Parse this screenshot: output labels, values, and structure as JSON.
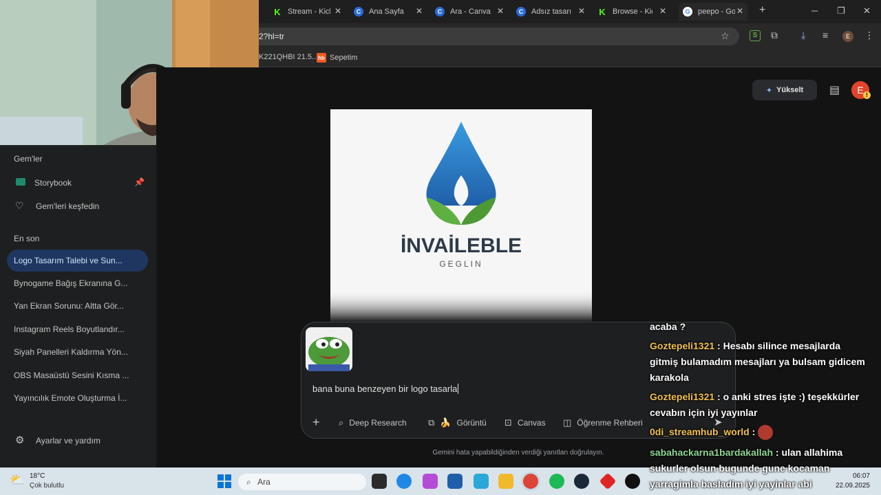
{
  "tabs": [
    {
      "title": "Stream - Kick",
      "icon": "kick-icon"
    },
    {
      "title": "Ana Sayfa - Canva",
      "icon": "canva-icon"
    },
    {
      "title": "Ara - Canva",
      "icon": "canva-icon"
    },
    {
      "title": "Adsız tasarım",
      "icon": "canva-icon"
    },
    {
      "title": "Browse - Kick",
      "icon": "kick-icon"
    },
    {
      "title": "peepo - Google",
      "icon": "google-icon"
    }
  ],
  "address_bar": {
    "url_fragment": "2?hl=tr"
  },
  "bookmarks": [
    {
      "label": "K221QHBI 21.5..."
    },
    {
      "label": "Sepetim",
      "icon": "hb"
    }
  ],
  "profile_initial": "E",
  "sidebar": {
    "gems_heading": "Gem'ler",
    "gems": [
      {
        "label": "Storybook"
      },
      {
        "label": "Gem'leri keşfedin"
      }
    ],
    "recent_heading": "En son",
    "recent": [
      "Logo Tasarım Talebi ve Sun...",
      "Bynogame Bağış Ekranına G...",
      "Yan Ekran Sorunu: Altta Gör...",
      "Instagram Reels Boyutlandır...",
      "Siyah Panelleri Kaldırma Yön...",
      "OBS Masaüstü Sesini Kısma ...",
      "Yayıncılık Emote Oluşturma İ..."
    ],
    "settings_label": "Ayarlar ve yardım"
  },
  "header": {
    "upgrade_label": "Yükselt",
    "avatar_initial": "E"
  },
  "generated_image": {
    "brand": "İNVAİLEBLE",
    "sub": "GEGLIN",
    "colors": {
      "drop": "#2b74c5",
      "leaf": "#5fb043",
      "text": "#2d3b48"
    }
  },
  "composer": {
    "prompt_text": "bana buna benzeyen bir logo tasarla",
    "tools": [
      "Deep Research",
      "Görüntü",
      "Canvas",
      "Öğrenme Rehberi"
    ]
  },
  "disclaimer": "Gemini hata yapabildiğinden verdiği yanıtları doğrulayın.",
  "chat_overlay": [
    {
      "user": "",
      "text": "acaba ?"
    },
    {
      "user": "Goztepeli1321",
      "text": ": Hesabı silince mesajlarda"
    },
    {
      "user": "",
      "text": "gitmiş bulamadım mesajları ya bulsam gidicem"
    },
    {
      "user": "",
      "text": "karakola"
    },
    {
      "user": "Goztepeli1321",
      "text": ": o anki stres işte :) teşekkürler"
    },
    {
      "user": "",
      "text": "cevabın için iyi yayınlar"
    },
    {
      "user": "0di_streamhub_world",
      "text": ":"
    },
    {
      "user": "sabahackarna1bardakallah",
      "text": ": ulan allahima"
    },
    {
      "user": "",
      "text": "sukurler olsun bugunde gune kocaman"
    },
    {
      "user": "",
      "text": "yarragimla basladim iyi yayinlar abi"
    }
  ],
  "taskbar": {
    "weather_temp": "18°C",
    "weather_desc": "Çok bulutlu",
    "search_placeholder": "Ara",
    "time": "06:07",
    "date": "22.09.2025"
  }
}
